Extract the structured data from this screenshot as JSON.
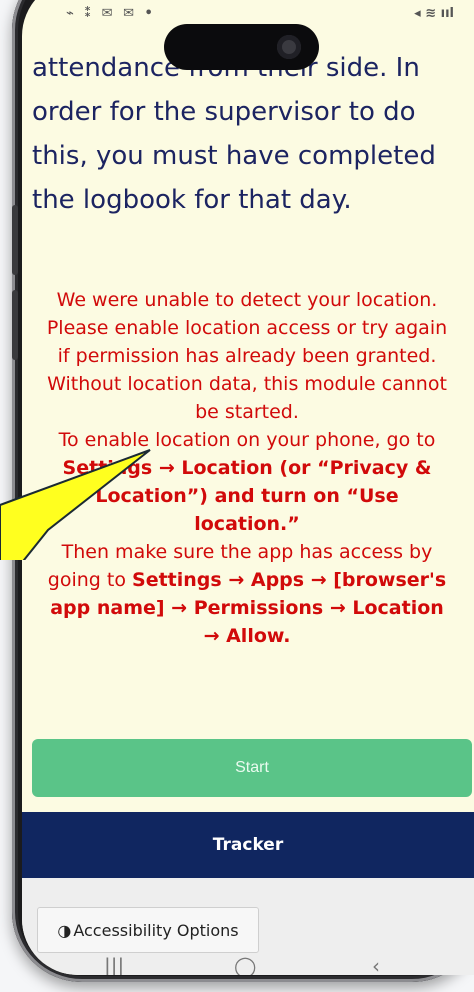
{
  "statusbar": {
    "left_icons": "⌁ ⁑ ✉ ✉ •",
    "right_icons": "◂ ≋ ııl"
  },
  "intro": {
    "line1_visible": "attendance from their side. In",
    "body": "order for the supervisor to do this, you must have completed the logbook for that day."
  },
  "warning": {
    "p1": "We were unable to detect your location. Please enable location access or try again if permission has already been granted. Without location data, this module cannot be started.",
    "p2_prefix": "To enable location on your phone, go to",
    "p2_bold": "Settings → Location (or “Privacy & Location”) and turn on “Use location.”",
    "p3_prefix": "Then make sure the app has access by going to",
    "p3_bold": "Settings → Apps → [browser's app name] → Permissions → Location → Allow."
  },
  "buttons": {
    "start": "Start",
    "tracker": "Tracker",
    "accessibility": "Accessibility Options"
  },
  "icons": {
    "accessibility": "contrast-icon",
    "nav_recents": "recents-icon",
    "nav_home": "home-icon",
    "nav_back": "back-icon"
  },
  "colors": {
    "screen_bg": "#fcfbe2",
    "intro_text": "#1c2461",
    "warning_text": "#d10a0a",
    "start_bg": "#5ac488",
    "tracker_bg": "#102660",
    "callout": "#ffff1f"
  }
}
